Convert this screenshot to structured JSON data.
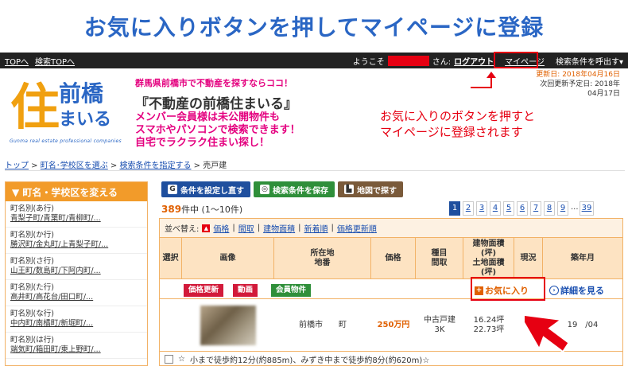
{
  "banner": {
    "title": "お気に入りボタンを押してマイページに登録"
  },
  "topbar": {
    "links": [
      "TOPへ",
      "検索TOPへ"
    ],
    "welcome": "ようこそ",
    "san": "さん:",
    "logout": "ログアウト",
    "mypage": "マイページ",
    "recall": "検索条件を呼出す▾"
  },
  "header": {
    "logo": {
      "ju": "住",
      "mae": "前橋",
      "mai": "まいる",
      "sub": "Gunma real estate professional companies"
    },
    "tagline": "群馬県前橋市で不動産を探すならココ！",
    "title": "『不動産の前橋住まいる』",
    "desc": [
      "メンバー会員様は未公開物件も",
      "スマホやパソコンで検索できます！",
      "自宅でラクラク住まい探し！"
    ],
    "update1": "更新日: 2018年04月16日",
    "update2": "次回更新予定日: 2018年04月17日"
  },
  "callout": {
    "lines": [
      "お気に入りのボタンを押すと",
      "マイページに登録されます"
    ]
  },
  "breadcrumb": {
    "items": [
      "トップ",
      "町名･学校区を選ぶ",
      "検索条件を指定する"
    ],
    "current": "売戸建",
    "sep": " > "
  },
  "sidebar": {
    "title": "▼ 町名・学校区を変える",
    "items": [
      {
        "l1": "町名別(あ行)",
        "l2": "青梨子町/青葉町/青柳町/..."
      },
      {
        "l1": "町名別(か行)",
        "l2": "勝沢町/金丸町/上青梨子町/..."
      },
      {
        "l1": "町名別(さ行)",
        "l2": "山王町/数島町/下阿内町/..."
      },
      {
        "l1": "町名別(た行)",
        "l2": "高井町/高花台/田口町/..."
      },
      {
        "l1": "町名別(な行)",
        "l2": "中内町/南橘町/新堀町/..."
      },
      {
        "l1": "町名別(は行)",
        "l2": "端気町/箱田町/東上野町/..."
      }
    ]
  },
  "buttons": {
    "reset": "条件を設定し直す",
    "save": "検索条件を保存",
    "map": "地図で探す"
  },
  "results": {
    "count": "389",
    "count_suffix": "件中 (1〜10件)",
    "pages": [
      "1",
      "2",
      "3",
      "4",
      "5",
      "6",
      "7",
      "8",
      "9",
      "...",
      "39"
    ],
    "sort_label": "並べ替え:",
    "sort_links": [
      "価格",
      "間取",
      "建物面積",
      "新着順",
      "価格更新順"
    ],
    "headers": [
      "選択",
      "画像",
      "所在地\n地番",
      "価格",
      "種目\n間取",
      "建物面積\n(坪)\n土地面積\n(坪)",
      "現況",
      "築年月"
    ],
    "tags": [
      "価格更新",
      "動画",
      "会員物件"
    ],
    "favorite": "お気に入り",
    "detail": "詳細を見る",
    "row": {
      "location": "前橋市　　町",
      "price": "250万円",
      "type": "中古戸建\n3K",
      "area": "16.24坪\n22.73坪",
      "status": "-",
      "built": "19　/04"
    },
    "footer": "小まで徒歩約12分(約885m)、みずき中まで徒歩約8分(約620m)☆"
  },
  "colors": {
    "accent": "#e60012",
    "brand": "#2a66c4",
    "orange": "#f29b2a"
  }
}
